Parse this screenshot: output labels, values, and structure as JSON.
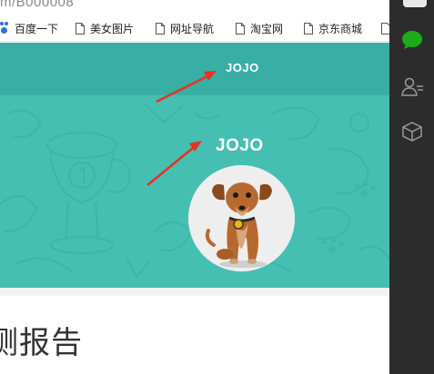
{
  "browser": {
    "url_fragment": "m/B000008",
    "bookmarks": [
      {
        "label": "百度一下",
        "icon": "paw-icon"
      },
      {
        "label": "美女图片",
        "icon": "document-icon"
      },
      {
        "label": "网址导航",
        "icon": "document-icon"
      },
      {
        "label": "淘宝网",
        "icon": "document-icon"
      },
      {
        "label": "京东商城",
        "icon": "document-icon"
      }
    ]
  },
  "header": {
    "title": "JOJO"
  },
  "banner": {
    "title": "JOJO",
    "avatar": "dog-avatar"
  },
  "page": {
    "heading": "测报告"
  },
  "sidebar": {
    "icons": [
      "chat-bubble-icon",
      "contacts-icon",
      "cube-icon"
    ],
    "accent": "#1aad19"
  },
  "colors": {
    "header": "#38aea4",
    "banner": "#46bfb3",
    "annotation_arrow": "#e8321f"
  }
}
